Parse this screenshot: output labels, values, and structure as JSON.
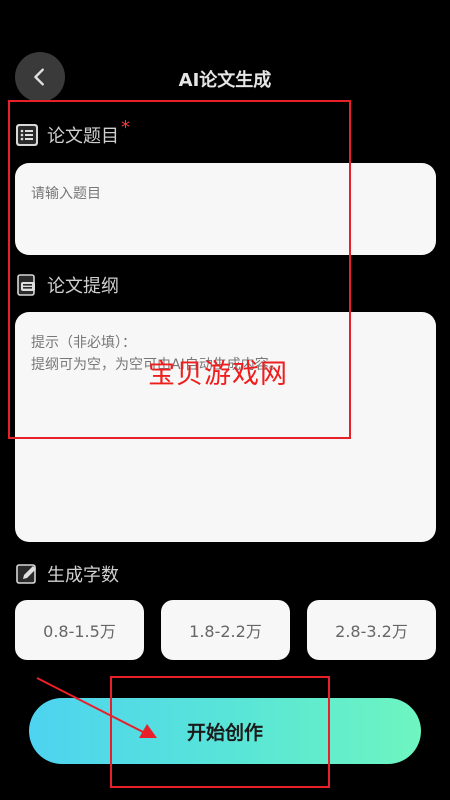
{
  "header": {
    "title": "AI论文生成"
  },
  "title_section": {
    "label": "论文题目",
    "required_mark": "*",
    "placeholder": "请输入题目"
  },
  "outline_section": {
    "label": "论文提纲",
    "hint_line1": "提示（非必填）：",
    "hint_line2": "提纲可为空，为空可由AI自动生成内容。"
  },
  "count_section": {
    "label": "生成字数",
    "options": [
      "0.8-1.5万",
      "1.8-2.2万",
      "2.8-3.2万"
    ]
  },
  "start_button": {
    "label": "开始创作"
  },
  "watermark": {
    "text": "宝贝游戏网"
  },
  "colors": {
    "background": "#000000",
    "card": "#f7f7f7",
    "accent_start": "#4ed3f0",
    "accent_end": "#6ef5c0",
    "annotation_red": "#e8202a"
  }
}
